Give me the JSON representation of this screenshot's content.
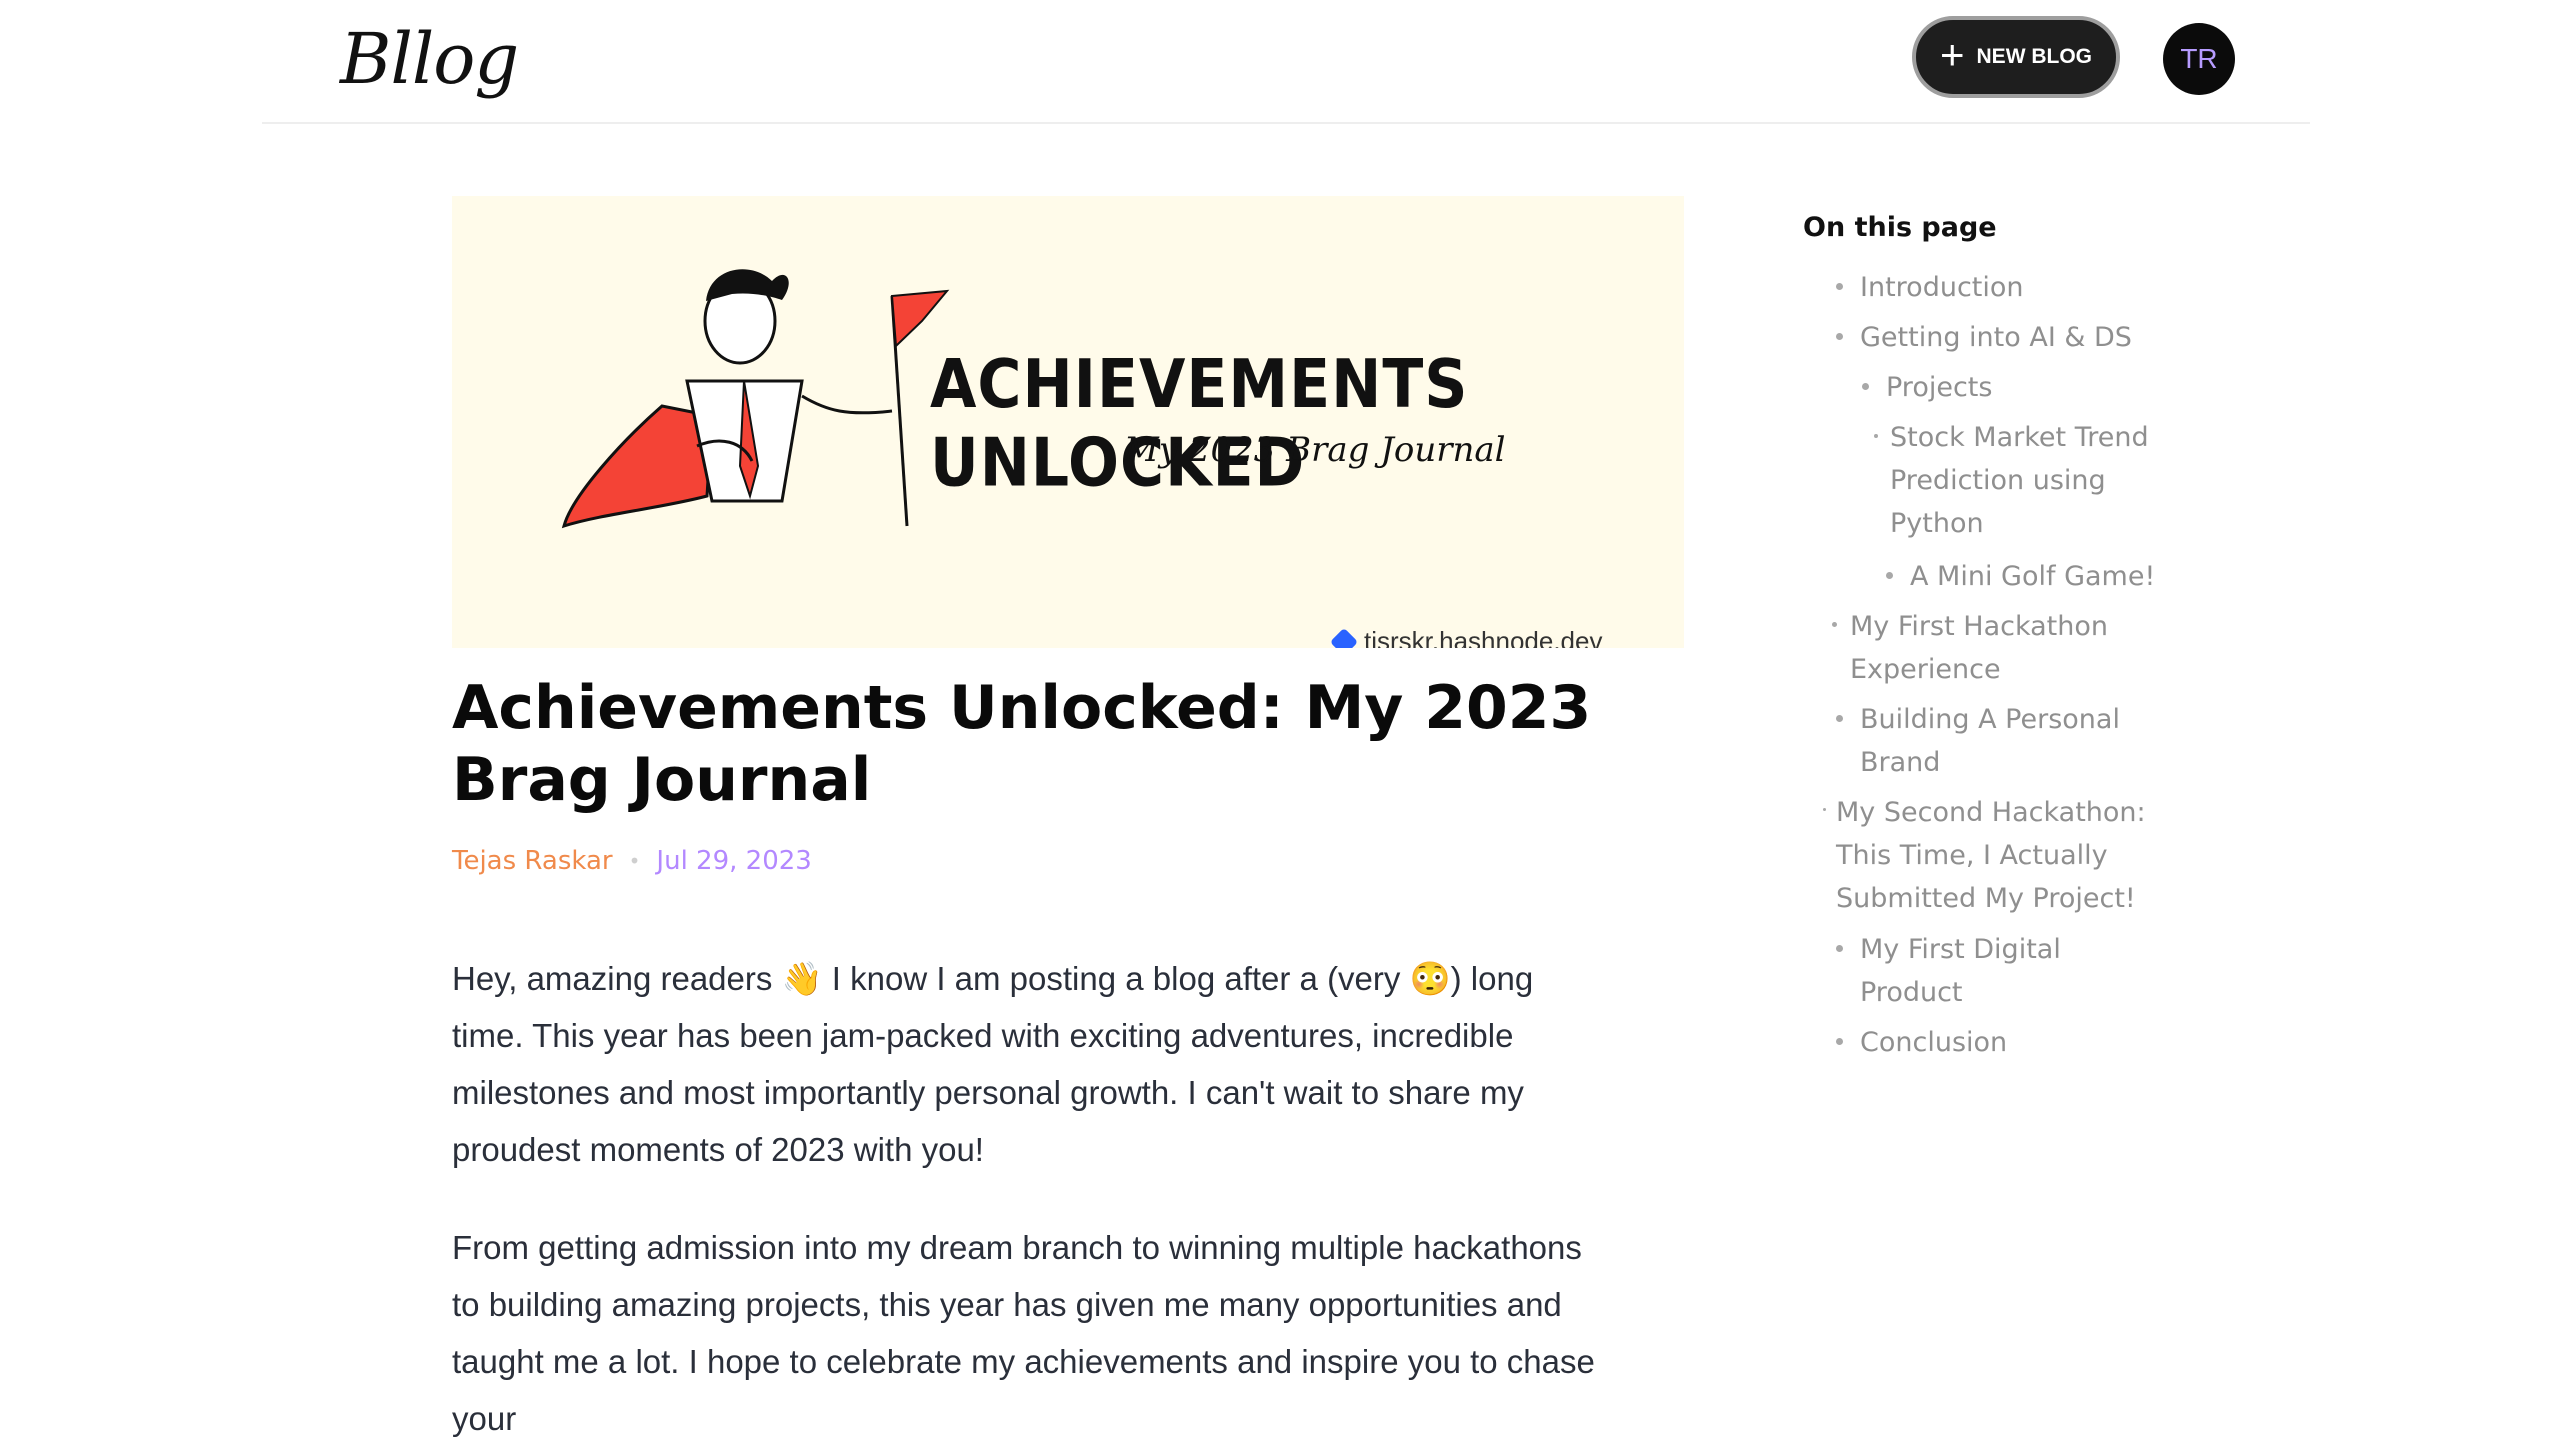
{
  "header": {
    "logo": "Bllog",
    "new_blog_label": "NEW BLOG",
    "avatar_initials": "TR"
  },
  "cover": {
    "title": "ACHIEVEMENTS UNLOCKED",
    "subtitle": "My 2023 Brag Journal",
    "footer": "tjsrskr.hashnode.dev"
  },
  "post": {
    "title": "Achievements Unlocked: My 2023 Brag Journal",
    "author": "Tejas Raskar",
    "date": "Jul 29, 2023",
    "paragraph1": "Hey, amazing readers 👋 I know I am posting a blog after a (very 😳) long time. This year has been jam-packed with exciting adventures, incredible milestones and most importantly personal growth. I can't wait to share my proudest moments of 2023 with you!",
    "paragraph2": "From getting admission into my dream branch to winning multiple hackathons to building amazing projects, this year has given me many opportunities and taught me a lot. I hope to celebrate my achievements and inspire you to chase your"
  },
  "toc": {
    "title": "On this page",
    "items": [
      "Introduction",
      "Getting into AI & DS",
      "Projects",
      "Stock Market Trend Prediction using Python",
      "A Mini Golf Game!",
      "My First Hackathon Experience",
      "Building A Personal Brand",
      "My Second Hackathon: This Time, I Actually Submitted My Project!",
      "My First Digital Product",
      "Conclusion"
    ]
  },
  "colors": {
    "author": "#f08a4b",
    "date": "#b388ff",
    "cover_bg": "#fffbea",
    "cape": "#f44336",
    "button_bg": "#1e1e1e"
  },
  "icons": [
    "plus-icon",
    "hashnode-icon"
  ]
}
